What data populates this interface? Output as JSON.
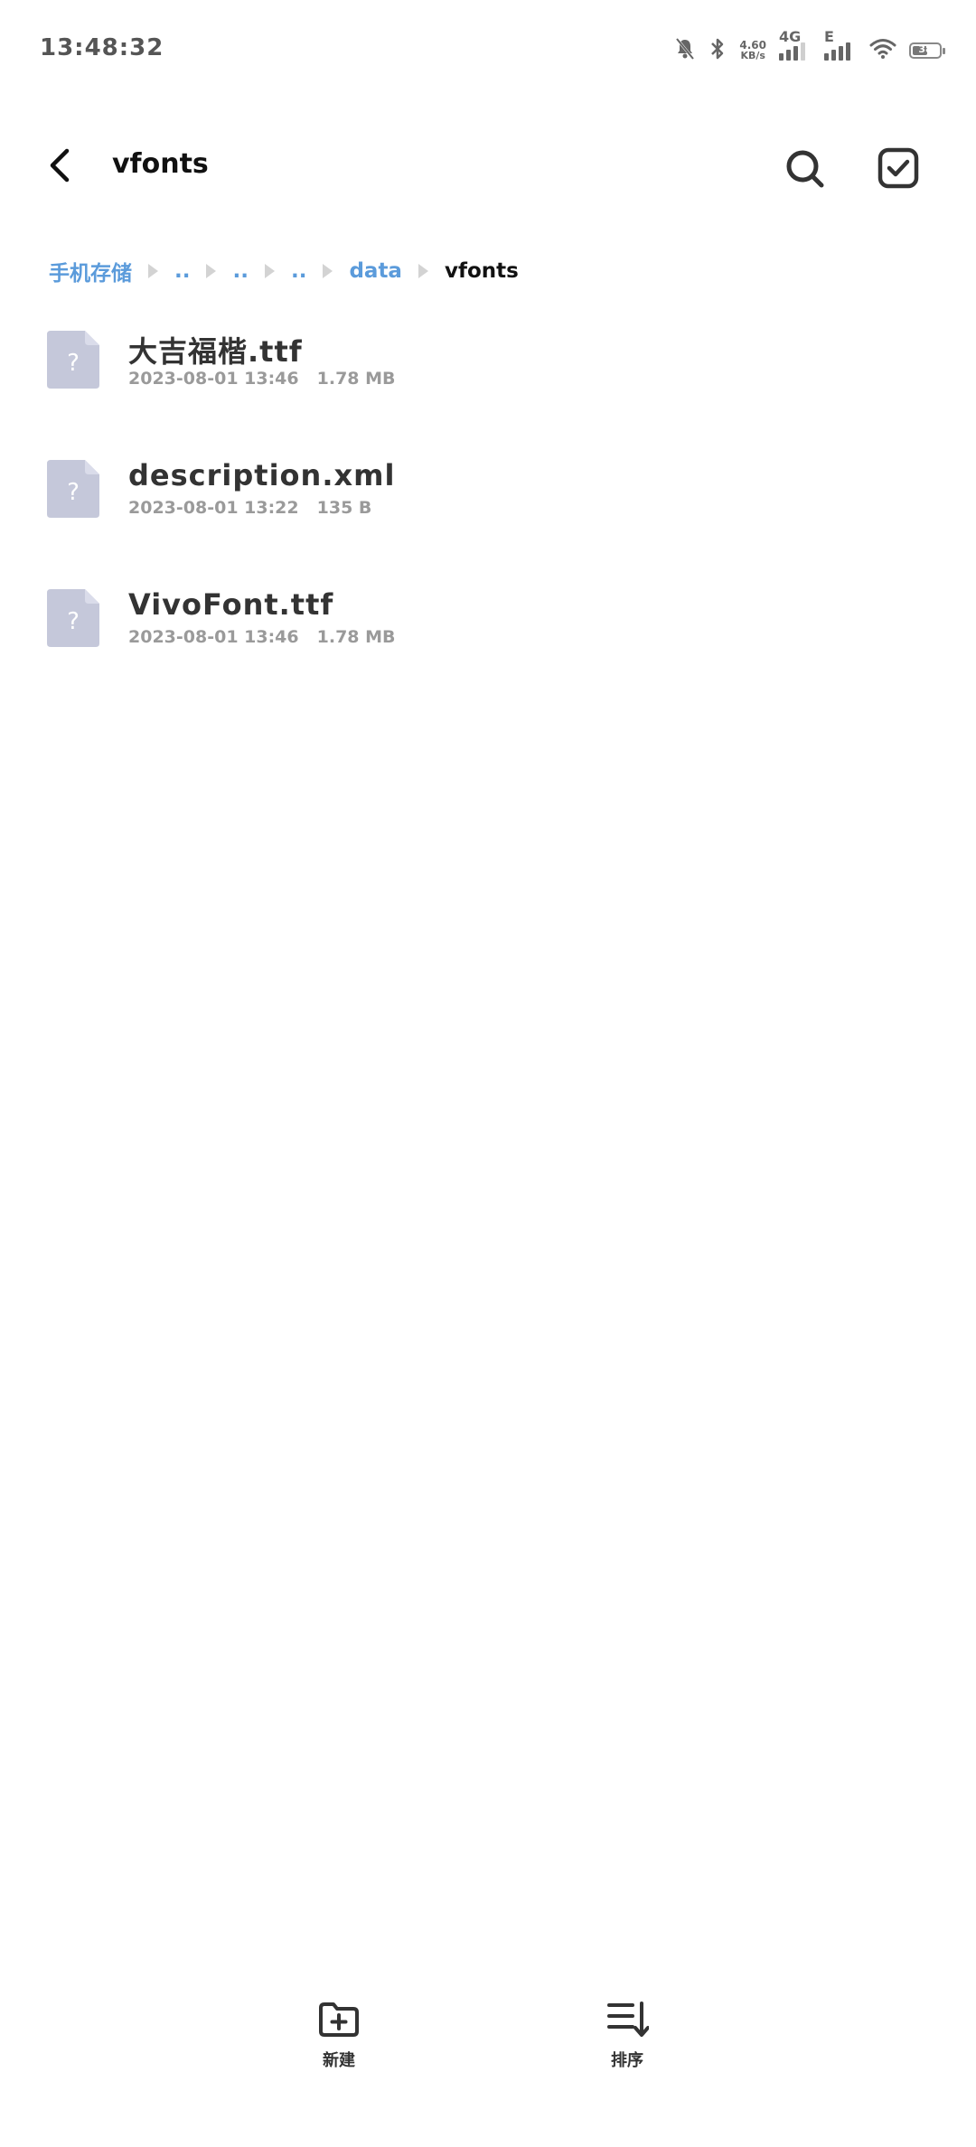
{
  "status_bar": {
    "time": "13:48:32",
    "net_speed_value": "4.60",
    "net_speed_unit": "KB/s",
    "signal1_label": "4G",
    "signal2_label": "E",
    "battery_level": "38",
    "icons": [
      "mute-icon",
      "bluetooth-icon",
      "signal-icon",
      "wifi-icon",
      "battery-icon"
    ]
  },
  "app_bar": {
    "title": "vfonts",
    "back_icon": "back-arrow-icon",
    "search_icon": "search-icon",
    "select_icon": "select-check-icon"
  },
  "breadcrumb": [
    {
      "label": "手机存储",
      "current": false
    },
    {
      "label": "..",
      "current": false
    },
    {
      "label": "..",
      "current": false
    },
    {
      "label": "..",
      "current": false
    },
    {
      "label": "data",
      "current": false
    },
    {
      "label": "vfonts",
      "current": true
    }
  ],
  "files": [
    {
      "name": "大吉福楷.ttf",
      "date": "2023-08-01 13:46",
      "size": "1.78 MB",
      "icon": "unknown-file-icon"
    },
    {
      "name": "description.xml",
      "date": "2023-08-01 13:22",
      "size": "135 B",
      "icon": "unknown-file-icon"
    },
    {
      "name": "VivoFont.ttf",
      "date": "2023-08-01 13:46",
      "size": "1.78 MB",
      "icon": "unknown-file-icon"
    }
  ],
  "bottom_bar": {
    "new_label": "新建",
    "sort_label": "排序"
  },
  "colors": {
    "accent": "#5b9bdb",
    "file_icon": "#c5c8da",
    "text_primary": "#333333",
    "text_secondary": "#9a9a9a"
  }
}
